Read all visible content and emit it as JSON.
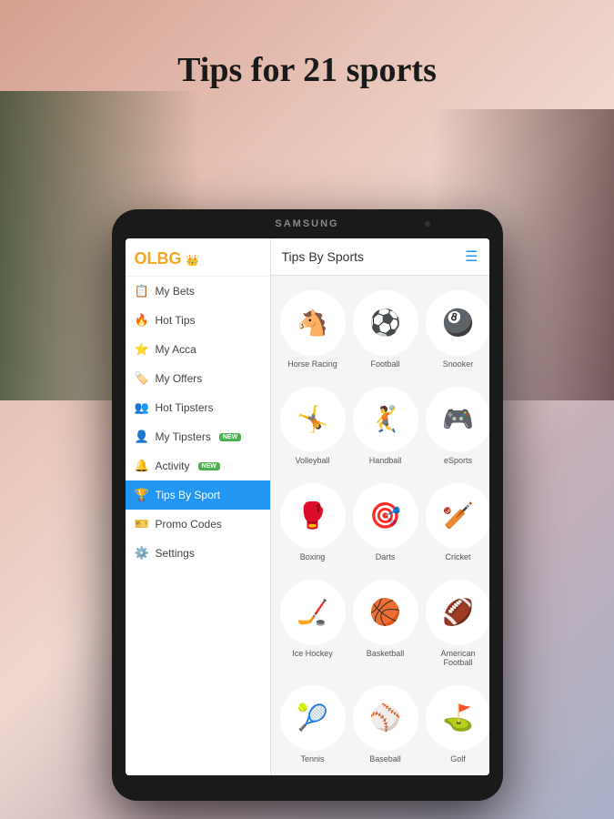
{
  "bg": {
    "title": "Tips for 21 sports"
  },
  "tablet": {
    "brand": "SAMSUNG"
  },
  "sidebar": {
    "logo": "OLBG",
    "items": [
      {
        "id": "my-bets",
        "label": "My Bets",
        "icon": "📋",
        "active": false
      },
      {
        "id": "hot-tips",
        "label": "Hot Tips",
        "icon": "🔥",
        "active": false
      },
      {
        "id": "my-acca",
        "label": "My Acca",
        "icon": "⭐",
        "active": false
      },
      {
        "id": "my-offers",
        "label": "My Offers",
        "icon": "🏷️",
        "active": false
      },
      {
        "id": "hot-tipsters",
        "label": "Hot Tipsters",
        "icon": "👥",
        "active": false
      },
      {
        "id": "my-tipsters",
        "label": "My Tipsters",
        "icon": "👤",
        "active": false,
        "badge": "NEW"
      },
      {
        "id": "activity",
        "label": "Activity",
        "icon": "🔔",
        "active": false,
        "badge": "NEW"
      },
      {
        "id": "tips-by-sport",
        "label": "Tips By Sport",
        "icon": "🏆",
        "active": true
      },
      {
        "id": "promo-codes",
        "label": "Promo Codes",
        "icon": "🎫",
        "active": false
      },
      {
        "id": "settings",
        "label": "Settings",
        "icon": "⚙️",
        "active": false
      }
    ]
  },
  "main": {
    "header_title": "Tips By Sports",
    "sports": [
      {
        "name": "Horse Racing",
        "emoji": "🐴"
      },
      {
        "name": "Football",
        "emoji": "⚽"
      },
      {
        "name": "Snooker",
        "emoji": "🎱"
      },
      {
        "name": "Volleyball",
        "emoji": "🤸"
      },
      {
        "name": "Handball",
        "emoji": "🤾"
      },
      {
        "name": "eSports",
        "emoji": "🎮"
      },
      {
        "name": "Boxing",
        "emoji": "🥊"
      },
      {
        "name": "Darts",
        "emoji": "🎯"
      },
      {
        "name": "Cricket",
        "emoji": "🏏"
      },
      {
        "name": "Ice Hockey",
        "emoji": "🏒"
      },
      {
        "name": "Basketball",
        "emoji": "🏀"
      },
      {
        "name": "American Football",
        "emoji": "🏈"
      },
      {
        "name": "Tennis",
        "emoji": "🎾"
      },
      {
        "name": "Baseball",
        "emoji": "⚾"
      },
      {
        "name": "Golf",
        "emoji": "⛳"
      }
    ]
  }
}
